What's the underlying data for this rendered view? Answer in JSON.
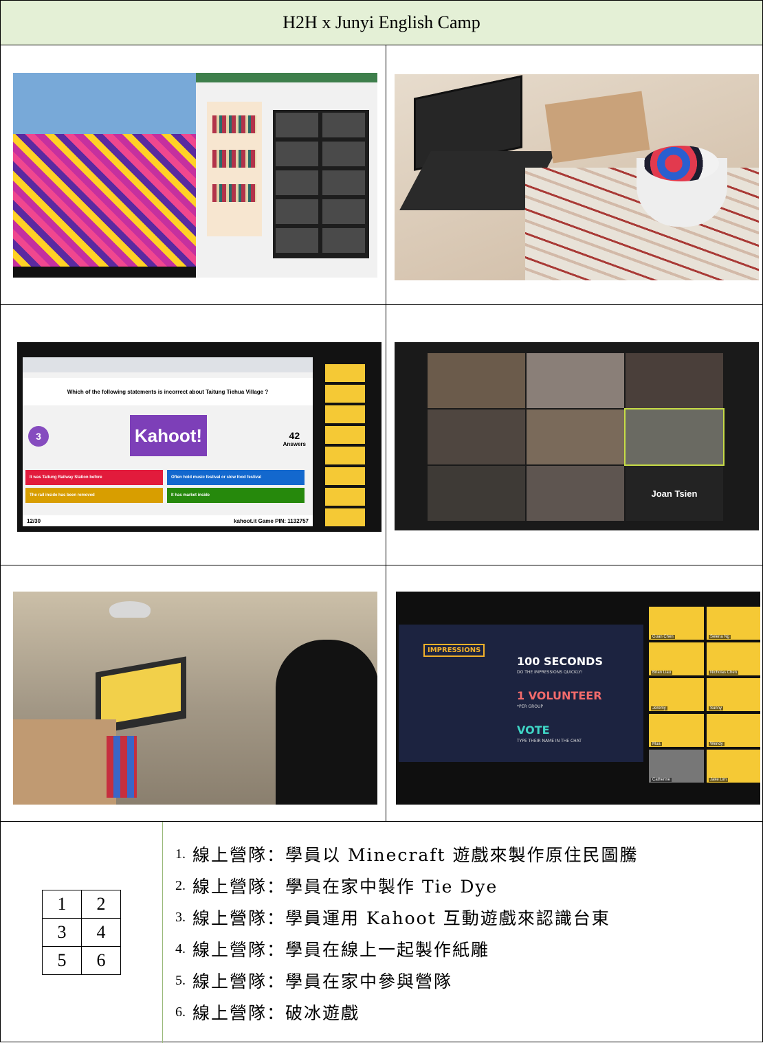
{
  "title": "H2H x Junyi English Camp",
  "photos": {
    "kahoot": {
      "question": "Which of the following statements is incorrect about Taitung Tiehua Village ?",
      "question_number": "3",
      "logo": "Kahoot!",
      "answers_count": "42",
      "answers_label": "Answers",
      "answers": [
        "It was Taitung Railway Station before",
        "Often hold music festival or slow food festival",
        "The rail inside has been removed",
        "It has market inside"
      ],
      "answer_colors": [
        "#e21b3c",
        "#1368ce",
        "#d89e00",
        "#26890c"
      ],
      "progress": "12/30",
      "pin_text": "kahoot.it Game PIN: 1132757"
    },
    "zoom_gallery": {
      "featured_name": "Joan Tsien"
    },
    "impressions": {
      "label": "IMPRESSIONS",
      "line1": "100 SECONDS",
      "line1_sub": "DO THE IMPRESSIONS QUICKLY!",
      "line2": "1 VOLUNTEER",
      "line2_sub": "*PER GROUP",
      "line3": "VOTE",
      "line3_sub": "TYPE THEIR NAME IN THE CHAT",
      "participants": [
        "Guan Chen",
        "Selena Ng",
        "Brian Liau",
        "Nicholas Chen",
        "Jeremy",
        "Sunny",
        "Mua",
        "Wendy",
        "Catherine",
        "Jake Lim"
      ]
    }
  },
  "legend_grid": [
    [
      "1",
      "2"
    ],
    [
      "3",
      "4"
    ],
    [
      "5",
      "6"
    ]
  ],
  "captions": [
    {
      "num": "1.",
      "text": "線上營隊：學員以 Minecraft 遊戲來製作原住民圖騰"
    },
    {
      "num": "2.",
      "text": "線上營隊：學員在家中製作 Tie Dye"
    },
    {
      "num": "3.",
      "text": "線上營隊：學員運用 Kahoot 互動遊戲來認識台東"
    },
    {
      "num": "4.",
      "text": "線上營隊：學員在線上一起製作紙雕"
    },
    {
      "num": "5.",
      "text": "線上營隊：學員在家中參與營隊"
    },
    {
      "num": "6.",
      "text": "線上營隊：破冰遊戲"
    }
  ]
}
